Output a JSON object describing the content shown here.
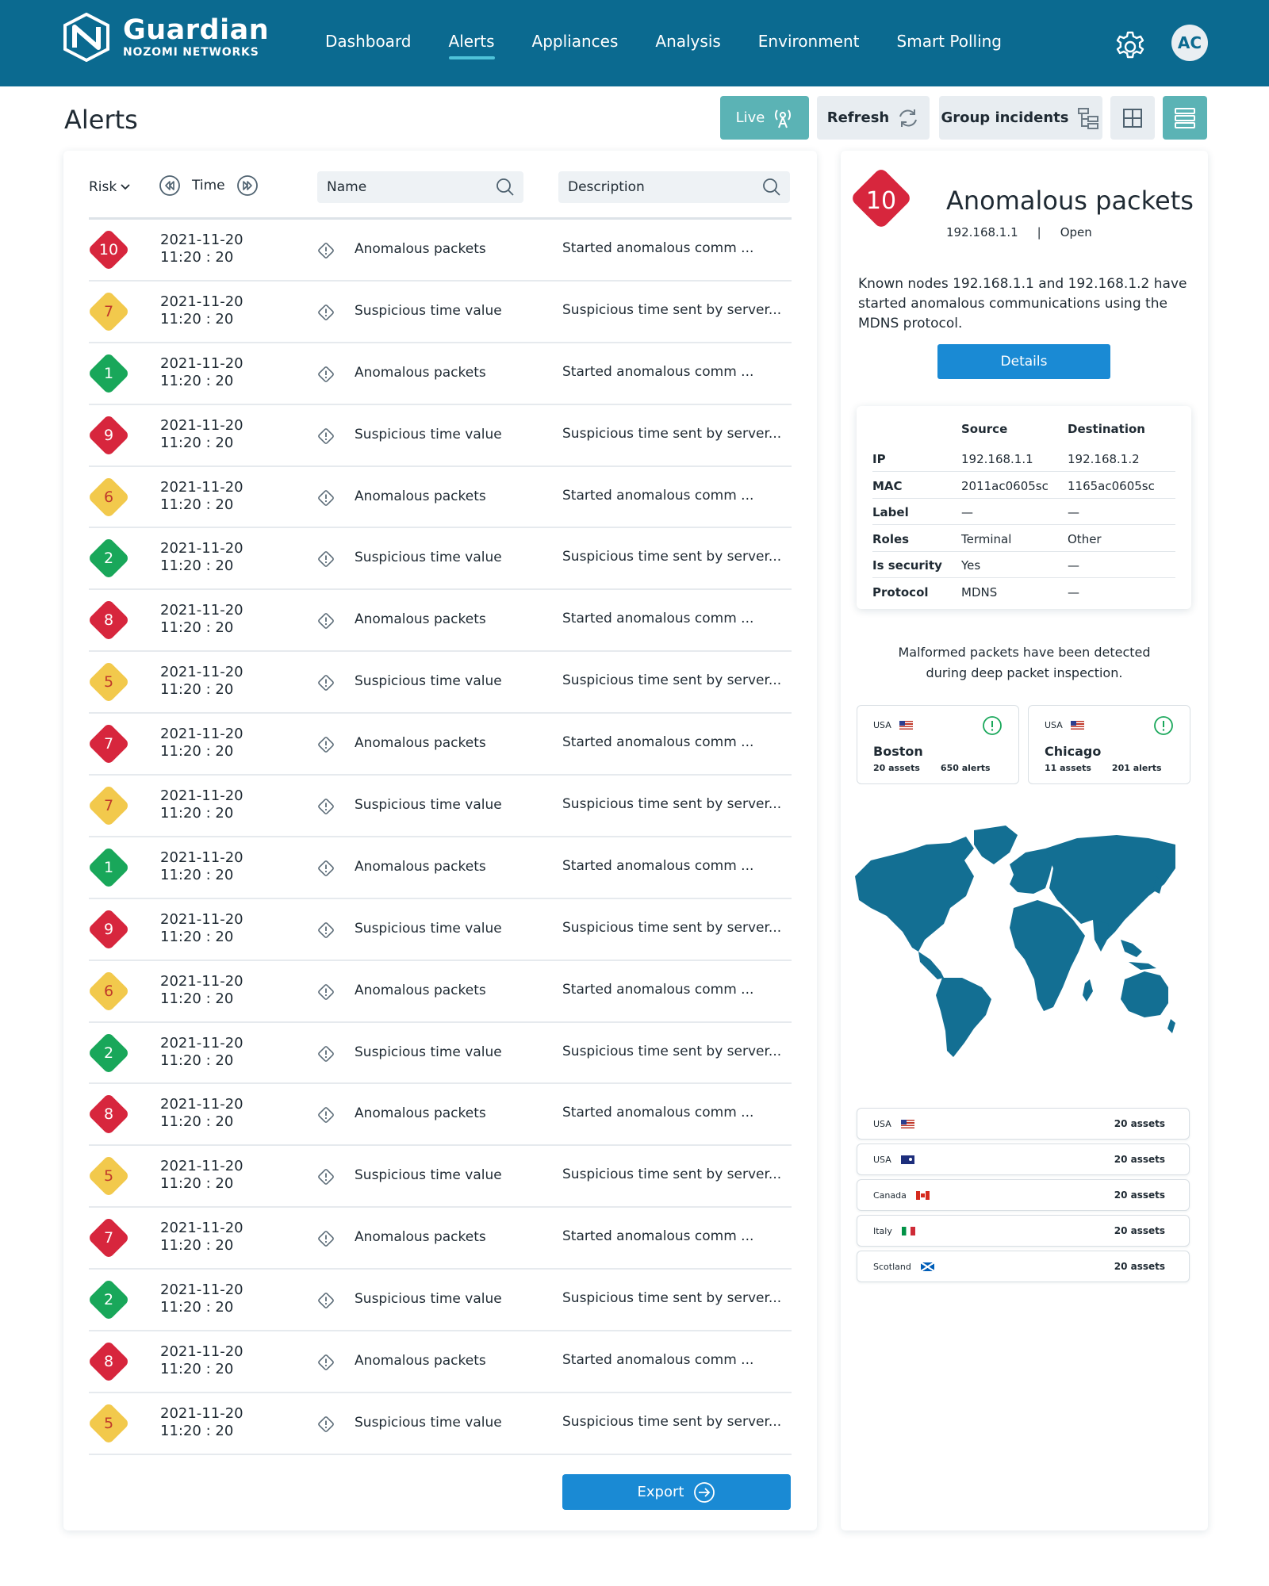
{
  "brand": {
    "name": "Guardian",
    "sub": "NOZOMI NETWORKS"
  },
  "nav": [
    {
      "label": "Dashboard",
      "active": false
    },
    {
      "label": "Alerts",
      "active": true
    },
    {
      "label": "Appliances",
      "active": false
    },
    {
      "label": "Analysis",
      "active": false
    },
    {
      "label": "Environment",
      "active": false
    },
    {
      "label": "Smart Polling",
      "active": false
    }
  ],
  "user": {
    "initials": "AC"
  },
  "page": {
    "title": "Alerts"
  },
  "toolbar": {
    "live": "Live",
    "refresh": "Refresh",
    "group": "Group incidents"
  },
  "table": {
    "risk": "Risk",
    "time": "Time",
    "name_placeholder": "Name",
    "desc_placeholder": "Description",
    "export": "Export"
  },
  "alerts": [
    {
      "risk": "10",
      "level": "red",
      "date": "2021-11-20",
      "time": "11:20 : 20",
      "name": "Anomalous packets",
      "desc": "Started anomalous comm ..."
    },
    {
      "risk": "7",
      "level": "yellow",
      "date": "2021-11-20",
      "time": "11:20 : 20",
      "name": "Suspicious time value",
      "desc": "Suspicious time sent by server..."
    },
    {
      "risk": "1",
      "level": "green",
      "date": "2021-11-20",
      "time": "11:20 : 20",
      "name": "Anomalous packets",
      "desc": "Started anomalous comm ..."
    },
    {
      "risk": "9",
      "level": "red",
      "date": "2021-11-20",
      "time": "11:20 : 20",
      "name": "Suspicious time value",
      "desc": "Suspicious time sent by server..."
    },
    {
      "risk": "6",
      "level": "yellow",
      "date": "2021-11-20",
      "time": "11:20 : 20",
      "name": "Anomalous packets",
      "desc": "Started anomalous comm ..."
    },
    {
      "risk": "2",
      "level": "green",
      "date": "2021-11-20",
      "time": "11:20 : 20",
      "name": "Suspicious time value",
      "desc": "Suspicious time sent by server..."
    },
    {
      "risk": "8",
      "level": "red",
      "date": "2021-11-20",
      "time": "11:20 : 20",
      "name": "Anomalous packets",
      "desc": "Started anomalous comm ..."
    },
    {
      "risk": "5",
      "level": "yellow",
      "date": "2021-11-20",
      "time": "11:20 : 20",
      "name": "Suspicious time value",
      "desc": "Suspicious time sent by server..."
    },
    {
      "risk": "7",
      "level": "red",
      "date": "2021-11-20",
      "time": "11:20 : 20",
      "name": "Anomalous packets",
      "desc": "Started anomalous comm ..."
    },
    {
      "risk": "7",
      "level": "yellow",
      "date": "2021-11-20",
      "time": "11:20 : 20",
      "name": "Suspicious time value",
      "desc": "Suspicious time sent by server..."
    },
    {
      "risk": "1",
      "level": "green",
      "date": "2021-11-20",
      "time": "11:20 : 20",
      "name": "Anomalous packets",
      "desc": "Started anomalous comm ..."
    },
    {
      "risk": "9",
      "level": "red",
      "date": "2021-11-20",
      "time": "11:20 : 20",
      "name": "Suspicious time value",
      "desc": "Suspicious time sent by server..."
    },
    {
      "risk": "6",
      "level": "yellow",
      "date": "2021-11-20",
      "time": "11:20 : 20",
      "name": "Anomalous packets",
      "desc": "Started anomalous comm ..."
    },
    {
      "risk": "2",
      "level": "green",
      "date": "2021-11-20",
      "time": "11:20 : 20",
      "name": "Suspicious time value",
      "desc": "Suspicious time sent by server..."
    },
    {
      "risk": "8",
      "level": "red",
      "date": "2021-11-20",
      "time": "11:20 : 20",
      "name": "Anomalous packets",
      "desc": "Started anomalous comm ..."
    },
    {
      "risk": "5",
      "level": "yellow",
      "date": "2021-11-20",
      "time": "11:20 : 20",
      "name": "Suspicious time value",
      "desc": "Suspicious time sent by server..."
    },
    {
      "risk": "7",
      "level": "red",
      "date": "2021-11-20",
      "time": "11:20 : 20",
      "name": "Anomalous packets",
      "desc": "Started anomalous comm ..."
    },
    {
      "risk": "2",
      "level": "green",
      "date": "2021-11-20",
      "time": "11:20 : 20",
      "name": "Suspicious time value",
      "desc": "Suspicious time sent by server..."
    },
    {
      "risk": "8",
      "level": "red",
      "date": "2021-11-20",
      "time": "11:20 : 20",
      "name": "Anomalous packets",
      "desc": "Started anomalous comm ..."
    },
    {
      "risk": "5",
      "level": "yellow",
      "date": "2021-11-20",
      "time": "11:20 : 20",
      "name": "Suspicious time value",
      "desc": "Suspicious time sent by server..."
    }
  ],
  "detail": {
    "risk": "10",
    "title": "Anomalous packets",
    "ip": "192.168.1.1",
    "separator": "|",
    "status": "Open",
    "text": "Known nodes 192.168.1.1 and 192.168.1.2 have started anomalous communications using the MDNS protocol.",
    "details_button": "Details",
    "info": {
      "source_head": "Source",
      "dest_head": "Destination",
      "rows": [
        {
          "key": "IP",
          "source": "192.168.1.1",
          "dest": "192.168.1.2"
        },
        {
          "key": "MAC",
          "source": "2011ac0605sc",
          "dest": "1165ac0605sc"
        },
        {
          "key": "Label",
          "source": "—",
          "dest": "—"
        },
        {
          "key": "Roles",
          "source": "Terminal",
          "dest": "Other"
        },
        {
          "key": "Is security",
          "source": "Yes",
          "dest": "—"
        },
        {
          "key": "Protocol",
          "source": "MDNS",
          "dest": "—"
        }
      ]
    },
    "note_line1": "Malformed packets have been detected",
    "note_line2": "during deep packet inspection.",
    "sites": [
      {
        "country": "USA",
        "city": "Boston",
        "assets": "20 assets",
        "alerts": "650 alerts"
      },
      {
        "country": "USA",
        "city": "Chicago",
        "assets": "11 assets",
        "alerts": "201 alerts"
      }
    ],
    "countries": [
      {
        "name": "USA",
        "flag": "us",
        "assets": "20 assets"
      },
      {
        "name": "USA",
        "flag": "au",
        "assets": "20 assets"
      },
      {
        "name": "Canada",
        "flag": "ca",
        "assets": "20 assets"
      },
      {
        "name": "Italy",
        "flag": "it",
        "assets": "20 assets"
      },
      {
        "name": "Scotland",
        "flag": "sc",
        "assets": "20 assets"
      }
    ]
  },
  "colors": {
    "nav_bg": "#0b6a90",
    "accent": "#1a8ad4",
    "teal": "#5bb3b5",
    "risk_red": "#d7263d",
    "risk_yellow": "#f2c94c",
    "risk_green": "#19a75a",
    "map": "#136f93"
  }
}
